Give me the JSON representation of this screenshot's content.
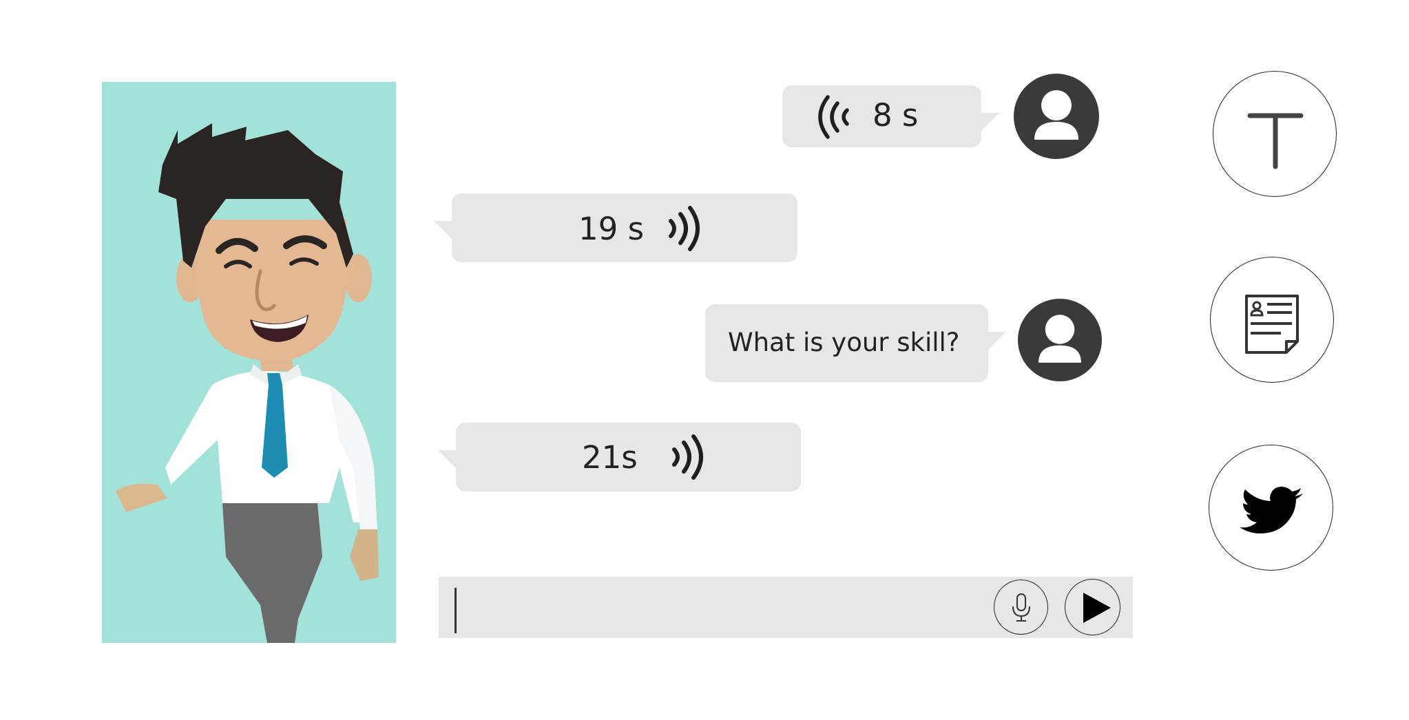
{
  "character": {
    "background_color": "#a3e2d8"
  },
  "messages": [
    {
      "side": "user",
      "type": "voice",
      "duration": "8 s",
      "icon": "sound-wave-icon"
    },
    {
      "side": "bot",
      "type": "voice",
      "duration": "19 s",
      "icon": "sound-wave-icon"
    },
    {
      "side": "user",
      "type": "text",
      "text": "What is your skill?"
    },
    {
      "side": "bot",
      "type": "voice",
      "duration": "21s",
      "icon": "sound-wave-icon"
    }
  ],
  "input": {
    "value": "",
    "mic_icon": "microphone-icon",
    "send_icon": "play-send-icon"
  },
  "side_buttons": [
    {
      "icon": "text-t-icon"
    },
    {
      "icon": "resume-document-icon"
    },
    {
      "icon": "twitter-bird-icon"
    }
  ],
  "colors": {
    "bubble": "#e7e7e7",
    "avatar": "#3a3a3a",
    "panel": "#a3e2d8"
  }
}
